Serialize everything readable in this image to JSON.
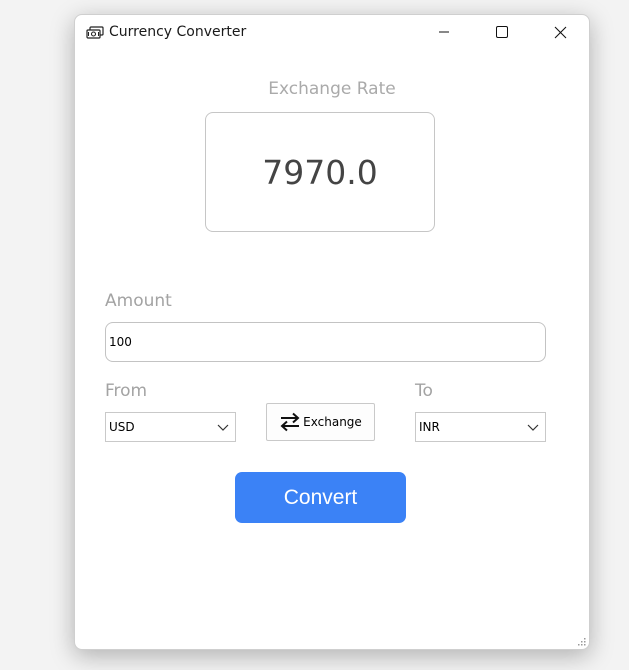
{
  "window": {
    "title": "Currency Converter",
    "icon": "money-icon",
    "controls": [
      "minimize-icon",
      "maximize-icon",
      "close-icon"
    ]
  },
  "exchange_rate": {
    "label": "Exchange Rate",
    "value": "7970.0"
  },
  "amount": {
    "label": "Amount",
    "value": "100"
  },
  "from": {
    "label": "From",
    "selected": "USD"
  },
  "to": {
    "label": "To",
    "selected": "INR"
  },
  "exchange_button": {
    "label": "Exchange",
    "icon": "swap-arrows-icon"
  },
  "convert_button": {
    "label": "Convert",
    "color": "#3b82f6"
  }
}
